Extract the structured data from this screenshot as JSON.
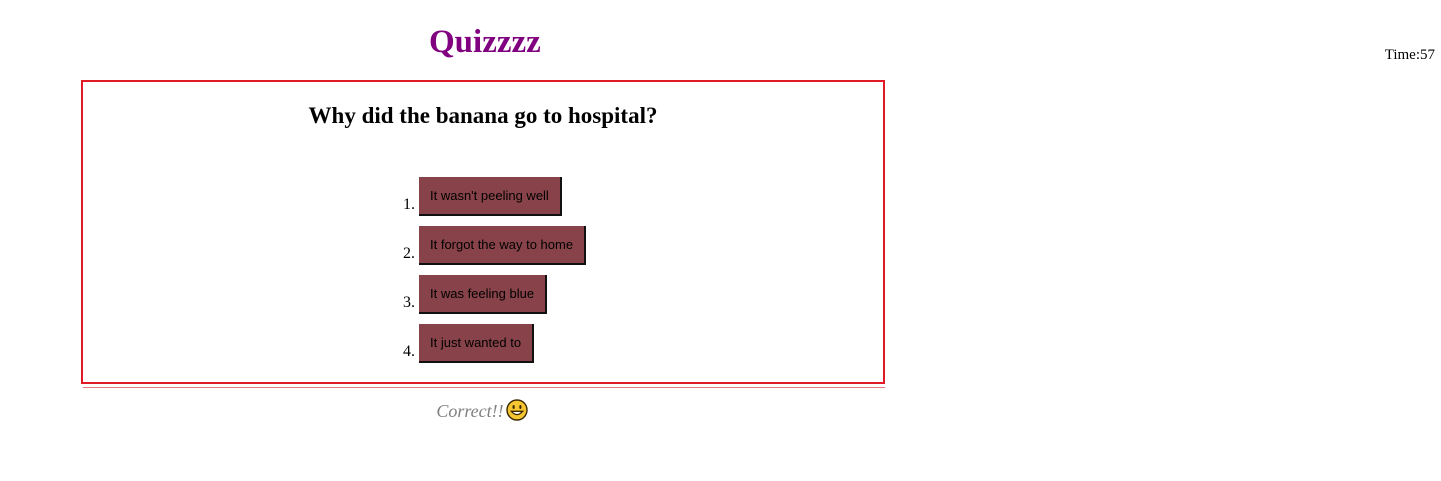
{
  "app": {
    "title": "Quizzzz"
  },
  "timer": {
    "text": "Time:57"
  },
  "quiz": {
    "question": "Why did the banana go to hospital?",
    "answers": [
      {
        "number": "1.",
        "label": "It wasn't peeling well"
      },
      {
        "number": "2.",
        "label": "It forgot the way to home"
      },
      {
        "number": "3.",
        "label": "It was feeling blue"
      },
      {
        "number": "4.",
        "label": "It just wanted to"
      }
    ],
    "answer_button_color": "#874349",
    "border_color": "#e01b24"
  },
  "feedback": {
    "text": "Correct!!",
    "icon": "grinning-face-icon"
  },
  "colors": {
    "title": "#800080",
    "feedback": "#808080"
  }
}
